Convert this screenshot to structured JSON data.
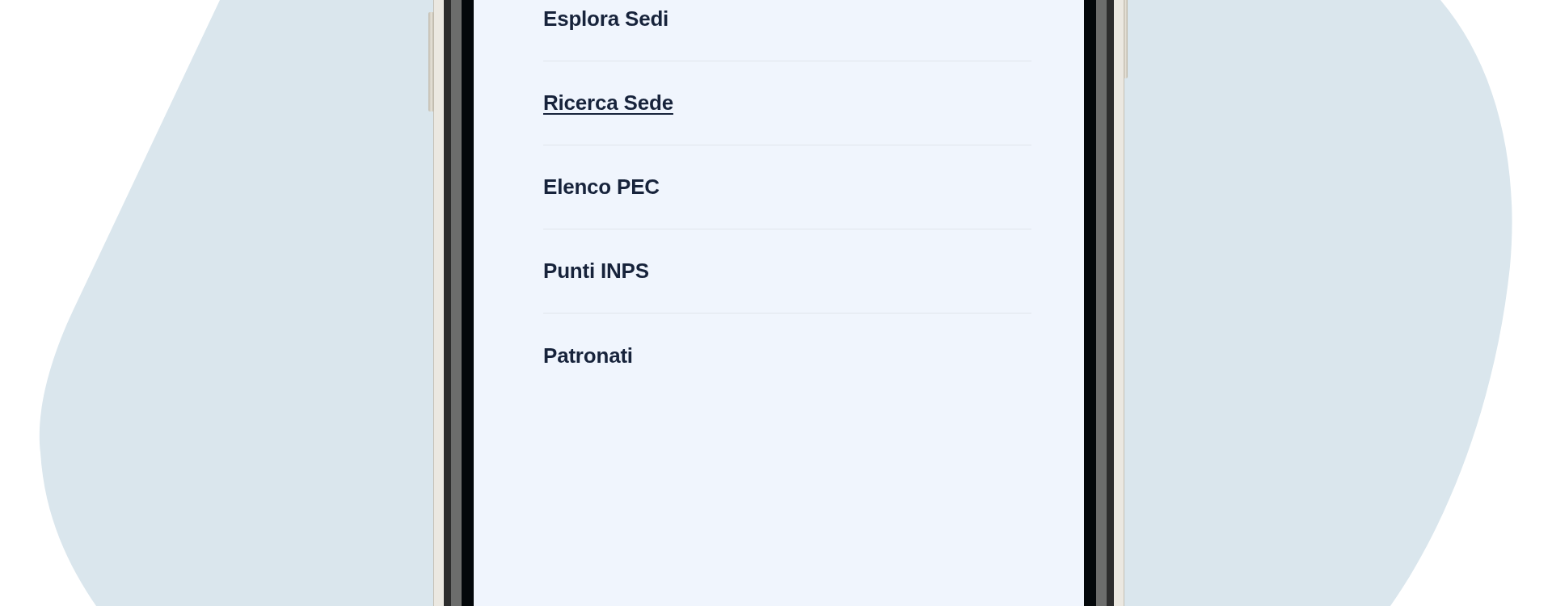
{
  "menu": {
    "items": [
      {
        "label": "Esplora Sedi",
        "hovered": false
      },
      {
        "label": "Ricerca Sede",
        "hovered": true
      },
      {
        "label": "Elenco PEC",
        "hovered": false
      },
      {
        "label": "Punti INPS",
        "hovered": false
      },
      {
        "label": "Patronati",
        "hovered": false
      }
    ]
  }
}
